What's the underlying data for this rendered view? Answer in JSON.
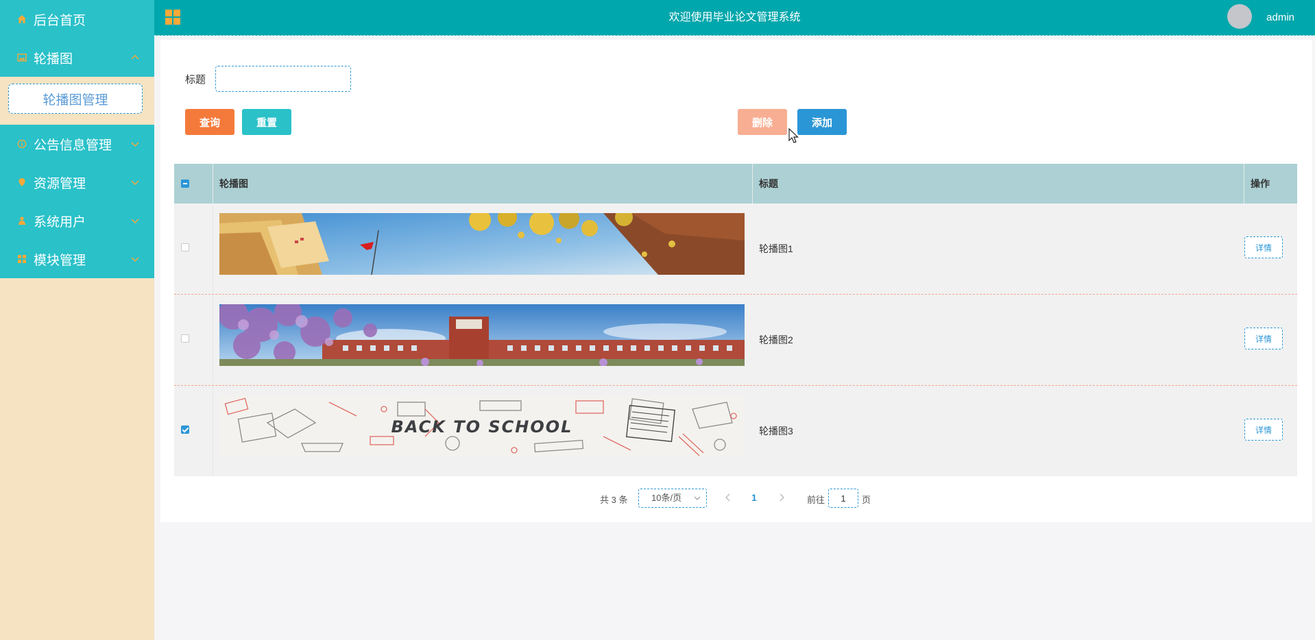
{
  "header": {
    "title": "欢迎使用毕业论文管理系统",
    "username": "admin"
  },
  "sidebar": {
    "items": [
      {
        "label": "后台首页",
        "icon": "home-icon"
      },
      {
        "label": "轮播图",
        "icon": "image-icon",
        "expanded": true
      },
      {
        "label": "公告信息管理",
        "icon": "info-icon"
      },
      {
        "label": "资源管理",
        "icon": "location-icon"
      },
      {
        "label": "系统用户",
        "icon": "user-icon"
      },
      {
        "label": "模块管理",
        "icon": "grid-icon"
      }
    ],
    "submenu": {
      "label": "轮播图管理"
    }
  },
  "search": {
    "label": "标题",
    "value": "",
    "placeholder": ""
  },
  "toolbar": {
    "query": "查询",
    "reset": "重置",
    "delete": "删除",
    "add": "添加"
  },
  "table": {
    "headers": {
      "image": "轮播图",
      "title": "标题",
      "action": "操作"
    },
    "rows": [
      {
        "title": "轮播图1",
        "checked": false,
        "detail": "详情",
        "image": "campus building with red flag and yellow leaves"
      },
      {
        "title": "轮播图2",
        "checked": false,
        "detail": "详情",
        "image": "campus clock tower with purple blossoms"
      },
      {
        "title": "轮播图3",
        "checked": true,
        "detail": "详情",
        "image": "back-to-school doodles"
      }
    ]
  },
  "banner3_text": "BACK TO SCHOOL",
  "pagination": {
    "total": "共 3 条",
    "page_size": "10条/页",
    "current": "1",
    "goto_label": "前往",
    "goto_value": "1",
    "page_suffix": "页"
  },
  "colors": {
    "accent": "#2ac1c9",
    "header": "#00a7ac",
    "primary": "#2b96d6",
    "orange": "#f47a3b",
    "sidebar_bg": "#f5e3c1"
  }
}
